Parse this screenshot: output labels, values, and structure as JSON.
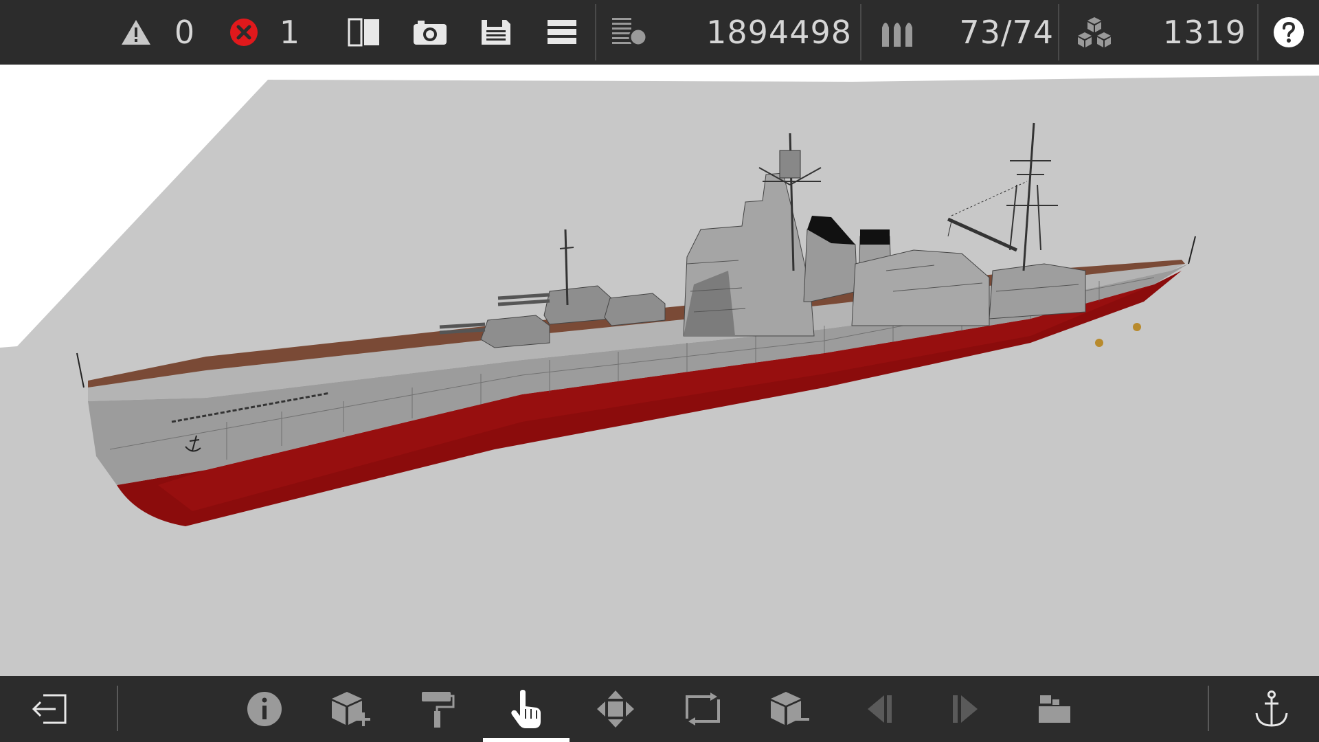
{
  "toolbar_top": {
    "warnings_count": "0",
    "errors_count": "1",
    "cost_value": "1894498",
    "ammo_value": "73/74",
    "parts_value": "1319",
    "icons": [
      "warning-icon",
      "error-icon",
      "mirror-view-icon",
      "camera-icon",
      "save-icon",
      "menu-icon",
      "weight-balance-icon",
      "ammo-icon",
      "parts-cubes-icon",
      "help-icon"
    ]
  },
  "toolbar_bottom": {
    "active_tool": "select-hand",
    "tools": [
      "exit",
      "info",
      "add-part",
      "paint",
      "select-hand",
      "move",
      "rotate",
      "remove-part",
      "previous",
      "next",
      "camera-mode",
      "anchor"
    ]
  },
  "colors": {
    "bar_bg": "#2c2c2c",
    "viewport_bg": "#c8c8c8",
    "hull_red": "#8b0c0c",
    "hull_gray": "#9a9a9a",
    "deck_wood": "#7a4a36",
    "error_red": "#e0191c"
  }
}
